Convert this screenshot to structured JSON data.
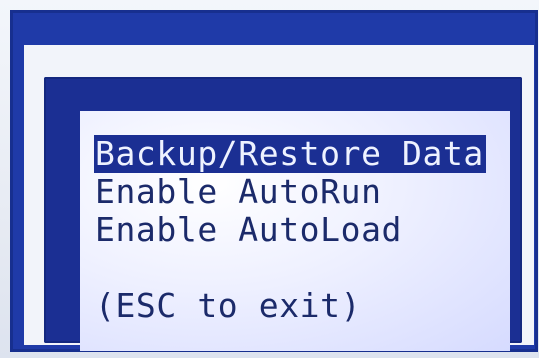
{
  "screen": {
    "menu_items": [
      {
        "label": "Backup/Restore Data",
        "selected": true
      },
      {
        "label": "Enable AutoRun",
        "selected": false
      },
      {
        "label": "Enable AutoLoad",
        "selected": false
      }
    ],
    "hint": "(ESC to exit)"
  },
  "colors": {
    "bezel_blue": "#1f3aa8",
    "lcd_text": "#1b2a6a",
    "selection_bg": "#1b2f93",
    "selection_text": "#eef2ff",
    "lcd_bg": "#eef0ff"
  }
}
